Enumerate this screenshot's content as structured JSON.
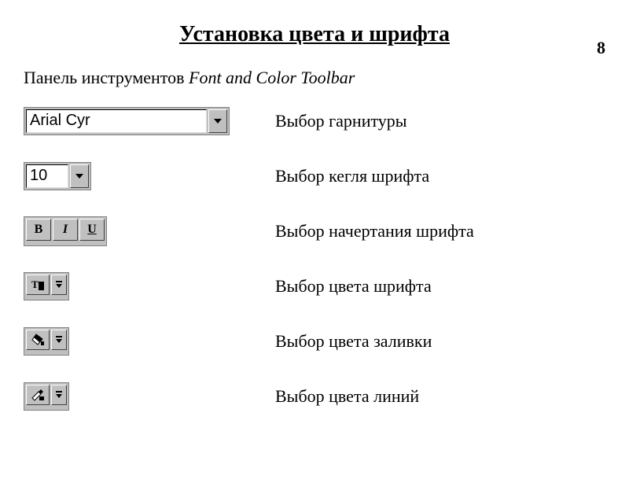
{
  "page_number": "8",
  "title": "Установка цвета и шрифта",
  "subtitle_prefix": "Панель инструментов ",
  "subtitle_italic": "Font and Color Toolbar",
  "rows": {
    "font": {
      "value": "Arial Cyr",
      "desc": "Выбор гарнитуры"
    },
    "size": {
      "value": "10",
      "desc": "Выбор кегля шрифта"
    },
    "style": {
      "b": "B",
      "i": "I",
      "u": "U",
      "desc": "Выбор начертания шрифта"
    },
    "text_color": {
      "desc": "Выбор цвета шрифта"
    },
    "fill_color": {
      "desc": "Выбор цвета заливки"
    },
    "line_color": {
      "desc": "Выбор цвета линий"
    }
  }
}
